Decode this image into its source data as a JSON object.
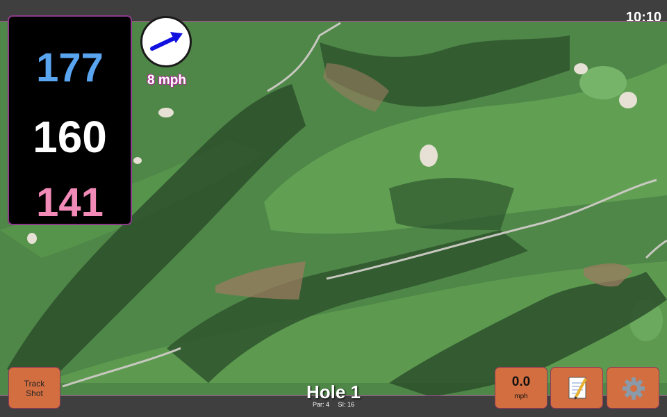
{
  "status_bar": {
    "time": "10:10"
  },
  "distances": {
    "back": "177",
    "middle": "160",
    "front": "141"
  },
  "wind": {
    "speed": "8 mph",
    "icon": "arrow-icon"
  },
  "buttons": {
    "track_shot_line1": "Track",
    "track_shot_line2": "Shot",
    "speed_value": "0.0",
    "speed_unit": "mph",
    "notes_icon": "notepad-icon",
    "settings_icon": "gear-icon"
  },
  "hole": {
    "title": "Hole 1",
    "par": "Par: 4",
    "si": "SI: 16"
  },
  "colors": {
    "back_distance": "#5aa5f0",
    "middle_distance": "#ffffff",
    "front_distance": "#f28ab8",
    "button_bg": "#d26e40",
    "panel_border": "#8e3a8a"
  }
}
